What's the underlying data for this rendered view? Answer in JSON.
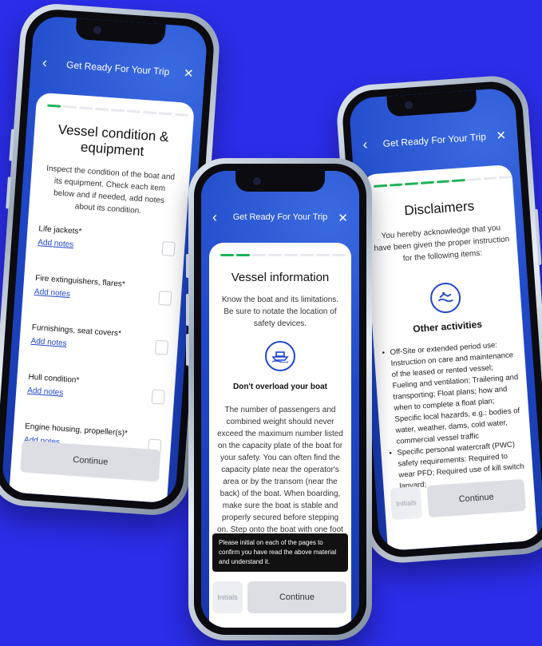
{
  "header": {
    "title": "Get Ready For Your Trip",
    "back_icon": "chevron-left-icon",
    "close_icon": "close-icon"
  },
  "screen1": {
    "title": "Vessel condition & equipment",
    "subtitle": "Inspect the condition of the boat and its equipment. Check each item below and if needed, add notes about its condition.",
    "items": [
      {
        "label": "Life jackets*",
        "notes": "Add notes"
      },
      {
        "label": "Fire extinguishers, flares*",
        "notes": "Add notes"
      },
      {
        "label": "Furnishings, seat covers*",
        "notes": "Add notes"
      },
      {
        "label": "Hull condition*",
        "notes": "Add notes"
      },
      {
        "label": "Engine housing, propeller(s)*",
        "notes": "Add notes"
      }
    ],
    "continue": "Continue"
  },
  "screen2": {
    "title": "Vessel information",
    "subtitle": "Know the boat and its limitations. Be sure to notate the location of safety devices.",
    "section_title": "Don't overload your boat",
    "body": "The number of passengers and combined weight should never exceed the maximum number listed on the capacity plate of the boat for your safety. You can often find the capacity plate near the operator's area or by the transom (near the back) of the boat. When boarding, make sure the boat is stable and properly secured before stepping on. Step onto the boat with one foot at a time, keeping your weight balanced and holding",
    "tooltip": "Please initial on each of the pages to confirm you have read the above material and understand it.",
    "initials": "Initials",
    "continue": "Continue"
  },
  "screen3": {
    "title": "Disclaimers",
    "subtitle": "You hereby acknowledge that you have been given the proper instruction for the following items:",
    "section_title": "Other activities",
    "bullets": [
      "Off-Site or extended period use: Instruction on care and maintenance of the leased or rented vessel; Fueling and ventilation; Trailering and transporting; Float plans; how and when to complete a float plan; Specific local hazards, e.g.: bodies of water, weather, dams, cold water, commercial vessel traffic",
      "Specific personal watercraft (PWC) safety requirements: Required to wear PFD; Required use of kill switch lanyard;"
    ],
    "initials": "Initials",
    "continue": "Continue"
  },
  "colors": {
    "background": "#2b2de8",
    "header": "#1d47c4",
    "progress": "#1fb35a",
    "link": "#2046c9"
  }
}
